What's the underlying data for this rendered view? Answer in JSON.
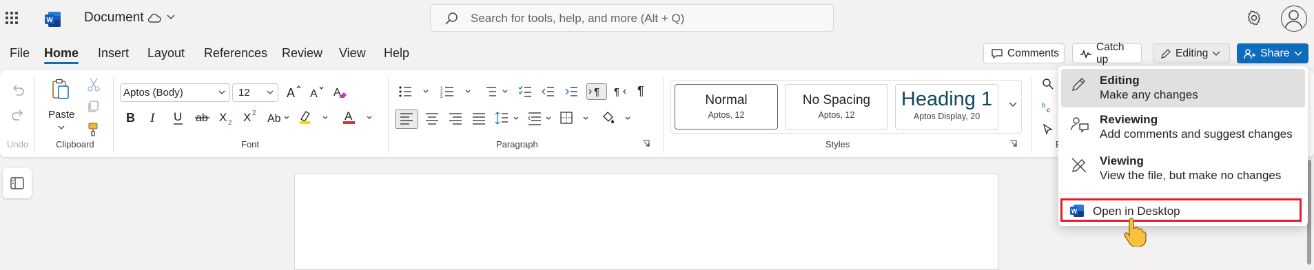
{
  "app": {
    "title": "Document",
    "brand_color": "#185abd",
    "accent": "#0f6cbd"
  },
  "search": {
    "placeholder": "Search for tools, help, and more (Alt + Q)"
  },
  "menu_tabs": [
    "File",
    "Home",
    "Insert",
    "Layout",
    "References",
    "Review",
    "View",
    "Help"
  ],
  "active_tab": "Home",
  "header_buttons": {
    "comments": "Comments",
    "catchup": "Catch up",
    "editing": "Editing",
    "share": "Share"
  },
  "ribbon": {
    "undo_label": "Undo",
    "clipboard_label": "Clipboard",
    "paste_label": "Paste",
    "font_label": "Font",
    "font_name": "Aptos (Body)",
    "font_size": "12",
    "paragraph_label": "Paragraph",
    "styles_label": "Styles",
    "styles": [
      {
        "name": "Normal",
        "sub": "Aptos, 12"
      },
      {
        "name": "No Spacing",
        "sub": "Aptos, 12"
      },
      {
        "name": "Heading 1",
        "sub": "Aptos Display, 20"
      }
    ],
    "cut_letter": "E"
  },
  "mode_menu": {
    "items": [
      {
        "title": "Editing",
        "desc": "Make any changes",
        "icon": "pencil-icon",
        "selected": true
      },
      {
        "title": "Reviewing",
        "desc": "Add comments and suggest changes",
        "icon": "reviewing-icon",
        "selected": false
      },
      {
        "title": "Viewing",
        "desc": "View the file, but make no changes",
        "icon": "no-edit-icon",
        "selected": false
      }
    ],
    "open_desktop": "Open in Desktop",
    "highlight_color": "#e21c2a"
  }
}
